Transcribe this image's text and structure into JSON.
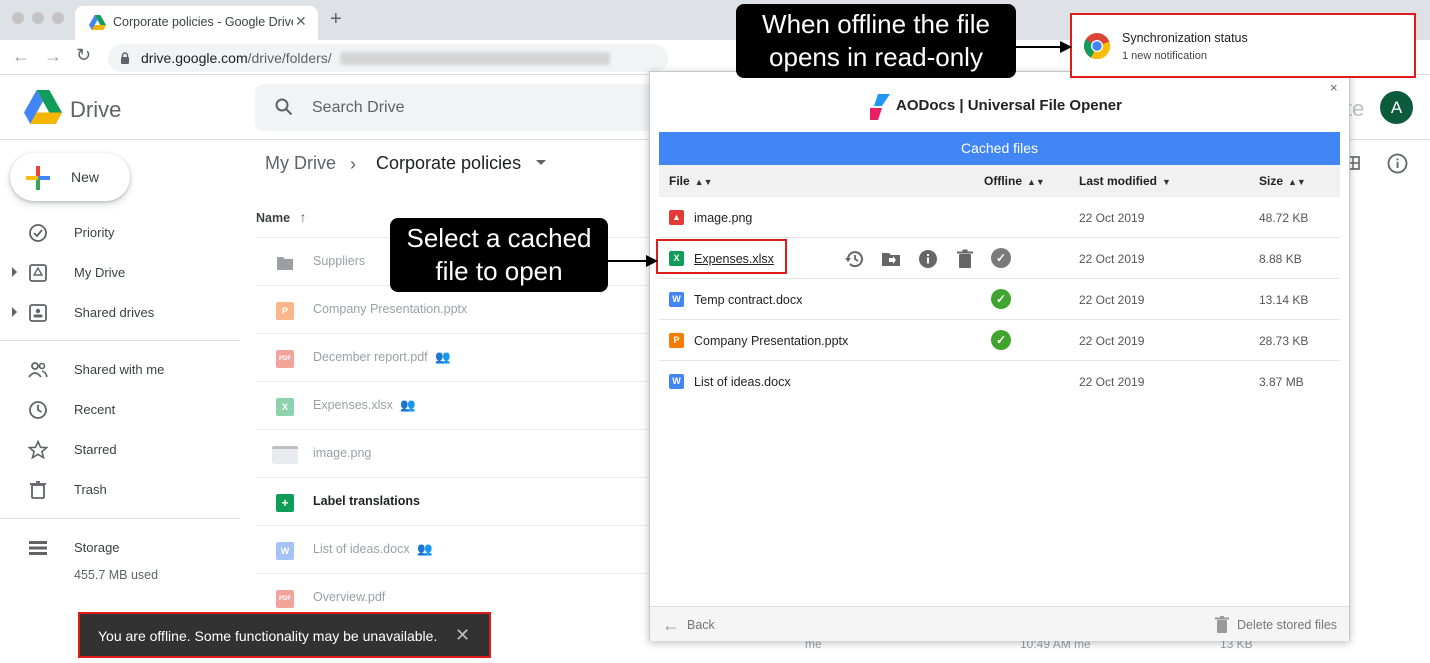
{
  "browser": {
    "tab_title": "Corporate policies - Google Drive",
    "url_host": "drive.google.com",
    "url_path": "/drive/folders/"
  },
  "drive": {
    "logo_text": "Drive",
    "search_placeholder": "Search Drive",
    "avatar_letter": "A",
    "header_ghost": "te",
    "new_label": "New",
    "nav": {
      "priority": "Priority",
      "my_drive": "My Drive",
      "shared_drives": "Shared drives",
      "shared_with_me": "Shared with me",
      "recent": "Recent",
      "starred": "Starred",
      "trash": "Trash",
      "storage": "Storage"
    },
    "storage_used": "455.7 MB used",
    "breadcrumb": {
      "root": "My Drive",
      "current": "Corporate policies"
    },
    "column_name": "Name",
    "files": [
      {
        "name": "Suppliers",
        "icon": "folder-icon"
      },
      {
        "name": "Company Presentation.pptx",
        "icon": "slides-icon"
      },
      {
        "name": "December report.pdf",
        "icon": "pdf-icon"
      },
      {
        "name": "Expenses.xlsx",
        "icon": "sheets-icon"
      },
      {
        "name": "image.png",
        "icon": "image-icon"
      },
      {
        "name": "Label translations",
        "icon": "sheets-icon"
      },
      {
        "name": "List of ideas.docx",
        "icon": "docs-icon"
      },
      {
        "name": "Overview.pdf",
        "icon": "pdf-icon"
      }
    ],
    "behind_dialog": {
      "owner": "me",
      "modified": "10:49 AM me",
      "size": "13 KB"
    }
  },
  "toast": {
    "text": "You are offline. Some functionality may be unavailable.",
    "close": "✕"
  },
  "dialog": {
    "title": "AODocs | Universal File Opener",
    "close": "×",
    "section": "Cached files",
    "columns": {
      "file": "File",
      "offline": "Offline",
      "last_modified": "Last modified",
      "size": "Size"
    },
    "rows": [
      {
        "name": "image.png",
        "type": "image",
        "offline": false,
        "date": "22 Oct 2019",
        "size": "48.72 KB"
      },
      {
        "name": "Expenses.xlsx",
        "type": "sheet",
        "offline": false,
        "date": "22 Oct 2019",
        "size": "8.88 KB"
      },
      {
        "name": "Temp contract.docx",
        "type": "doc",
        "offline": true,
        "date": "22 Oct 2019",
        "size": "13.14 KB"
      },
      {
        "name": "Company Presentation.pptx",
        "type": "slide",
        "offline": true,
        "date": "22 Oct 2019",
        "size": "28.73 KB"
      },
      {
        "name": "List of ideas.docx",
        "type": "doc",
        "offline": false,
        "date": "22 Oct 2019",
        "size": "3.87 MB"
      }
    ],
    "back": "Back",
    "delete": "Delete stored files"
  },
  "sync": {
    "title": "Synchronization status",
    "subtitle": "1 new notification"
  },
  "callouts": {
    "offline_line1": "When offline the file",
    "offline_line2": "opens in read-only",
    "select_line1": "Select a cached",
    "select_line2": "file to open"
  },
  "colors": {
    "accent": "#4285f4",
    "highlight": "#e01b1b",
    "offline_check": "#3fa52f"
  }
}
